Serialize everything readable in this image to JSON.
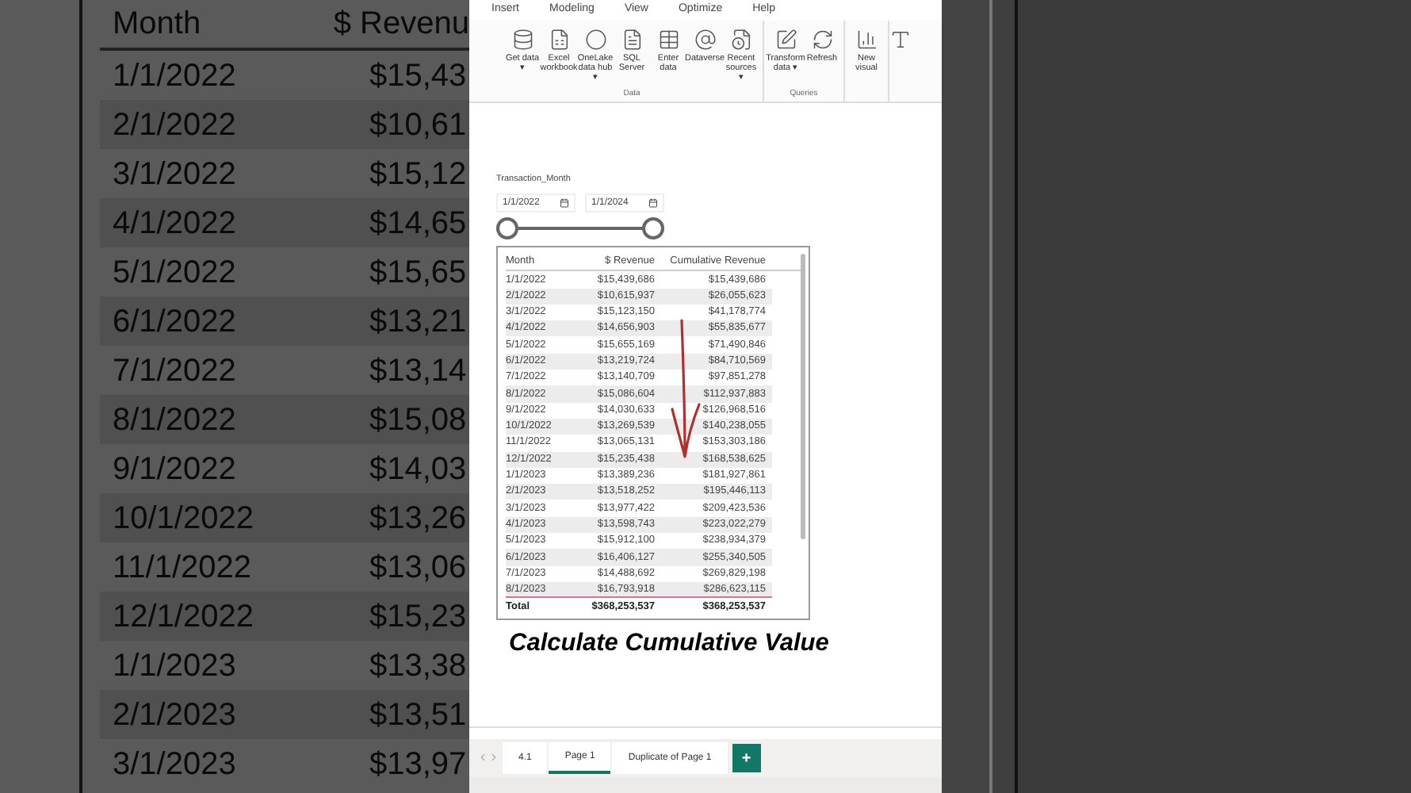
{
  "background_zoom": {
    "columns": [
      "Month",
      "$ Revenu"
    ],
    "rows": [
      [
        "1/1/2022",
        "$15,43"
      ],
      [
        "2/1/2022",
        "$10,61"
      ],
      [
        "3/1/2022",
        "$15,12"
      ],
      [
        "4/1/2022",
        "$14,65"
      ],
      [
        "5/1/2022",
        "$15,65"
      ],
      [
        "6/1/2022",
        "$13,21"
      ],
      [
        "7/1/2022",
        "$13,14"
      ],
      [
        "8/1/2022",
        "$15,08"
      ],
      [
        "9/1/2022",
        "$14,03"
      ],
      [
        "10/1/2022",
        "$13,26"
      ],
      [
        "11/1/2022",
        "$13,06"
      ],
      [
        "12/1/2022",
        "$15,23"
      ],
      [
        "1/1/2023",
        "$13,38"
      ],
      [
        "2/1/2023",
        "$13,51"
      ],
      [
        "3/1/2023",
        "$13,97"
      ]
    ]
  },
  "ribbon": {
    "tabs": [
      "Insert",
      "Modeling",
      "View",
      "Optimize",
      "Help"
    ],
    "groups": [
      {
        "label": "Data",
        "items": [
          {
            "kind": "database",
            "label": "Get data ▾"
          },
          {
            "kind": "excel",
            "label": "Excel workbook"
          },
          {
            "kind": "onelake",
            "label": "OneLake data hub ▾"
          },
          {
            "kind": "sql",
            "label": "SQL Server"
          },
          {
            "kind": "table",
            "label": "Enter data"
          },
          {
            "kind": "dataverse",
            "label": "Dataverse"
          },
          {
            "kind": "recent",
            "label": "Recent sources ▾"
          }
        ]
      },
      {
        "label": "Queries",
        "items": [
          {
            "kind": "transform",
            "label": "Transform data ▾"
          },
          {
            "kind": "refresh",
            "label": "Refresh"
          }
        ]
      },
      {
        "items": [
          {
            "kind": "visual",
            "label": "New visual"
          }
        ]
      }
    ]
  },
  "slicer": {
    "title": "Transaction_Month",
    "start": "1/1/2022",
    "end": "1/1/2024"
  },
  "table": {
    "columns": [
      "Month",
      "$ Revenue",
      "Cumulative Revenue"
    ],
    "rows": [
      [
        "1/1/2022",
        "$15,439,686",
        "$15,439,686"
      ],
      [
        "2/1/2022",
        "$10,615,937",
        "$26,055,623"
      ],
      [
        "3/1/2022",
        "$15,123,150",
        "$41,178,774"
      ],
      [
        "4/1/2022",
        "$14,656,903",
        "$55,835,677"
      ],
      [
        "5/1/2022",
        "$15,655,169",
        "$71,490,846"
      ],
      [
        "6/1/2022",
        "$13,219,724",
        "$84,710,569"
      ],
      [
        "7/1/2022",
        "$13,140,709",
        "$97,851,278"
      ],
      [
        "8/1/2022",
        "$15,086,604",
        "$112,937,883"
      ],
      [
        "9/1/2022",
        "$14,030,633",
        "$126,968,516"
      ],
      [
        "10/1/2022",
        "$13,269,539",
        "$140,238,055"
      ],
      [
        "11/1/2022",
        "$13,065,131",
        "$153,303,186"
      ],
      [
        "12/1/2022",
        "$15,235,438",
        "$168,538,625"
      ],
      [
        "1/1/2023",
        "$13,389,236",
        "$181,927,861"
      ],
      [
        "2/1/2023",
        "$13,518,252",
        "$195,446,113"
      ],
      [
        "3/1/2023",
        "$13,977,422",
        "$209,423,536"
      ],
      [
        "4/1/2023",
        "$13,598,743",
        "$223,022,279"
      ],
      [
        "5/1/2023",
        "$15,912,100",
        "$238,934,379"
      ],
      [
        "6/1/2023",
        "$16,406,127",
        "$255,340,505"
      ],
      [
        "7/1/2023",
        "$14,488,692",
        "$269,829,198"
      ],
      [
        "8/1/2023",
        "$16,793,918",
        "$286,623,115"
      ]
    ],
    "total": [
      "Total",
      "$368,253,537",
      "$368,253,537"
    ]
  },
  "caption": "Calculate Cumulative Value",
  "page_tabs": [
    {
      "label": "4.1",
      "selected": false
    },
    {
      "label": "Page 1",
      "selected": true
    },
    {
      "label": "Duplicate of Page 1",
      "selected": false
    }
  ],
  "add_page": "+"
}
